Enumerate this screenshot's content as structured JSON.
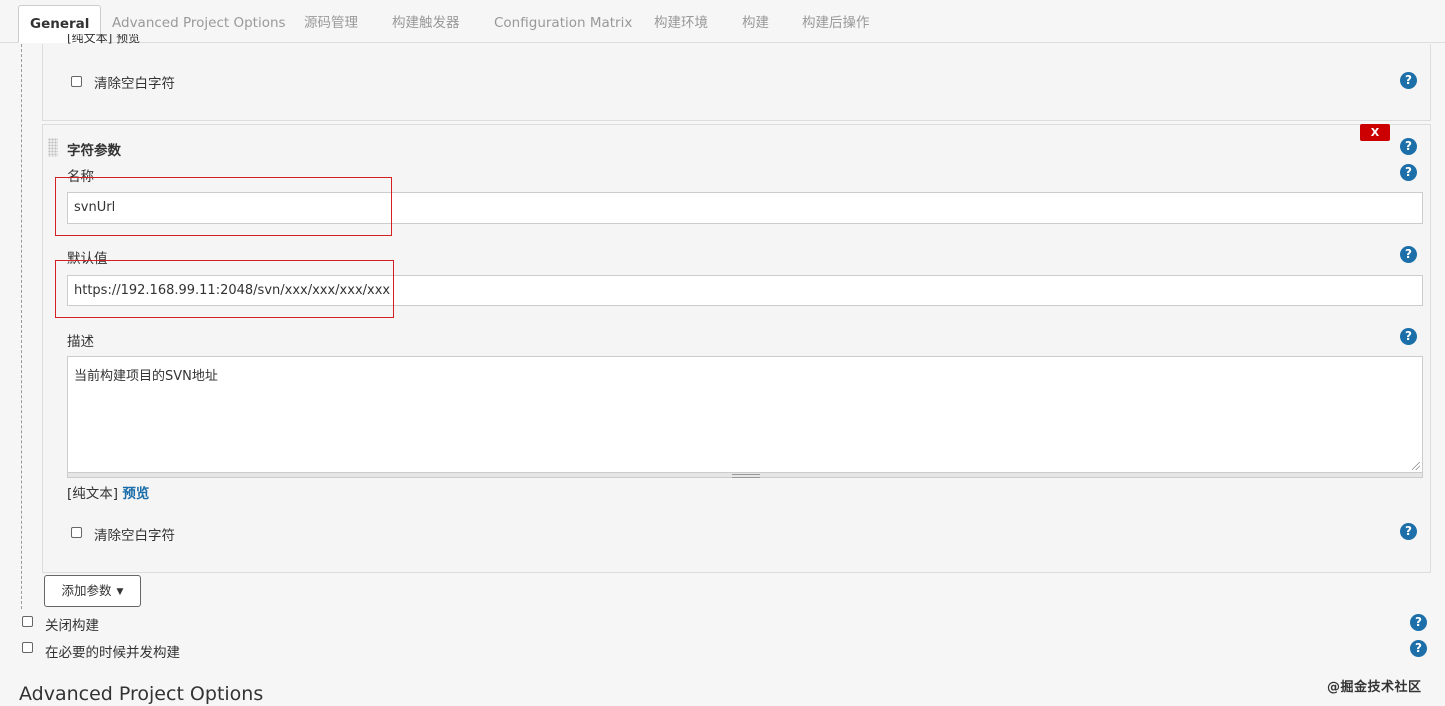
{
  "tabs": [
    {
      "label": "General",
      "active": true
    },
    {
      "label": "Advanced Project Options"
    },
    {
      "label": "源码管理"
    },
    {
      "label": "构建触发器"
    },
    {
      "label": "Configuration Matrix"
    },
    {
      "label": "构建环境"
    },
    {
      "label": "构建"
    },
    {
      "label": "构建后操作"
    }
  ],
  "prev_param": {
    "clipped_text": "[纯文本] 预览",
    "trim_label": "清除空白字符",
    "trim_checked": false
  },
  "string_param": {
    "title": "字符参数",
    "delete_label": "X",
    "name_label": "名称",
    "name_value": "svnUrl",
    "default_label": "默认值",
    "default_value": "https://192.168.99.11:2048/svn/xxx/xxx/xxx/xxx",
    "desc_label": "描述",
    "desc_value": "当前构建项目的SVN地址",
    "plain_text": "[纯文本]",
    "preview_link": "预览",
    "trim_label": "清除空白字符",
    "trim_checked": false
  },
  "add_param_button": "添加参数",
  "disable_build": {
    "label": "关闭构建",
    "checked": false
  },
  "concurrent_build": {
    "label": "在必要的时候并发构建",
    "checked": false
  },
  "section_heading": "Advanced Project Options",
  "watermark": "@掘金技术社区",
  "help_glyph": "?",
  "caret_glyph": "▼",
  "colors": {
    "help_icon": "#1c6fa8",
    "delete_button": "#cc0000",
    "highlight_box": "#d42020",
    "link": "#1a6da8"
  }
}
